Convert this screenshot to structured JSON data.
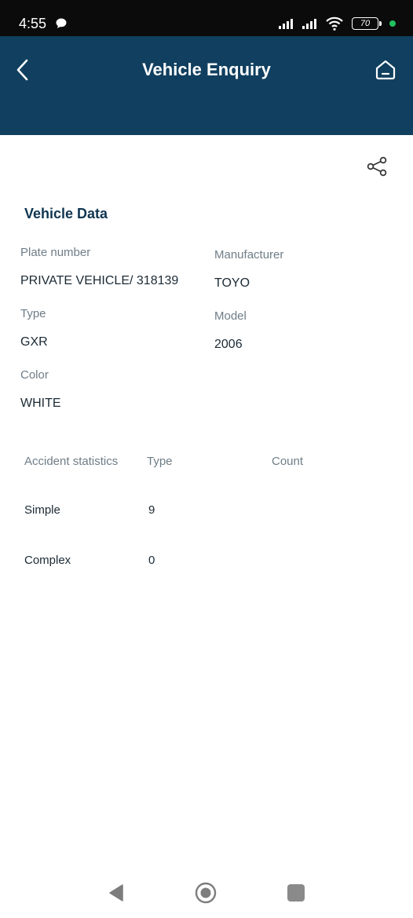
{
  "status_bar": {
    "time": "4:55",
    "battery": "70"
  },
  "header": {
    "title": "Vehicle Enquiry"
  },
  "vehicle_data": {
    "section_title": "Vehicle Data",
    "plate_label": "Plate number",
    "plate_value": "PRIVATE VEHICLE/ 318139",
    "manufacturer_label": "Manufacturer",
    "manufacturer_value": "TOYO",
    "type_label": "Type",
    "type_value": "GXR",
    "model_label": "Model",
    "model_value": "2006",
    "color_label": "Color",
    "color_value": "WHITE"
  },
  "accident_stats": {
    "headers": [
      "Accident statistics",
      "Type",
      "Count"
    ],
    "rows": [
      {
        "name": "Simple",
        "value": "9"
      },
      {
        "name": "Complex",
        "value": "0"
      }
    ]
  },
  "colors": {
    "header_bg": "#103f5f",
    "title_dark": "#0f3550",
    "status_dot": "#21c25e"
  }
}
